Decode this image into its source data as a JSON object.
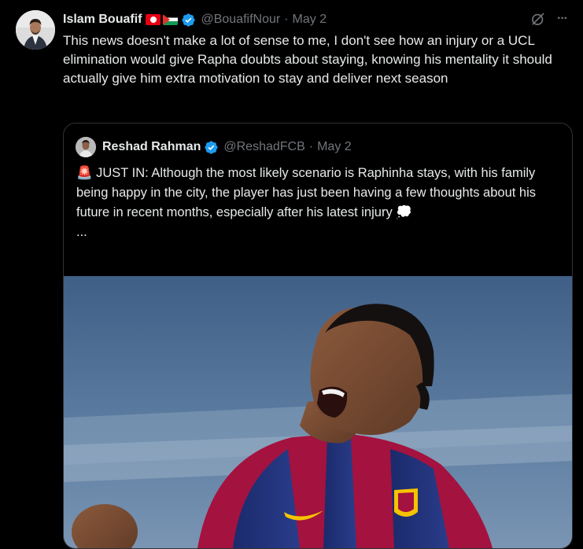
{
  "tweet": {
    "author_name": "Islam Bouafif",
    "author_handle": "@BouafifNour",
    "separator": "·",
    "date": "May 2",
    "text": "This news doesn't make a lot of sense to me, I don't see how an injury or a UCL elimination would give Rapha doubts about staying, knowing his mentality it should actually give him extra motivation to stay and deliver next season",
    "more_menu": "···"
  },
  "quote": {
    "author_name": "Reshad Rahman",
    "author_handle": "@ReshadFCB",
    "separator": "·",
    "date": "May 2",
    "siren": "🚨",
    "text": " JUST IN:  Although the most likely scenario is Raphinha stays, with his family being happy in the city, the player has just been having a few thoughts about his future in recent months, especially after his latest injury ",
    "thought": "💭",
    "more": "..."
  },
  "colors": {
    "background": "#000000",
    "text_primary": "#e7e9ea",
    "text_secondary": "#71767b",
    "verified_blue": "#1d9bf0",
    "border": "#2f3336"
  },
  "icons": [
    "verified-badge-icon",
    "grok-icon",
    "more-icon",
    "flag-tunisia-icon",
    "flag-palestine-icon"
  ]
}
